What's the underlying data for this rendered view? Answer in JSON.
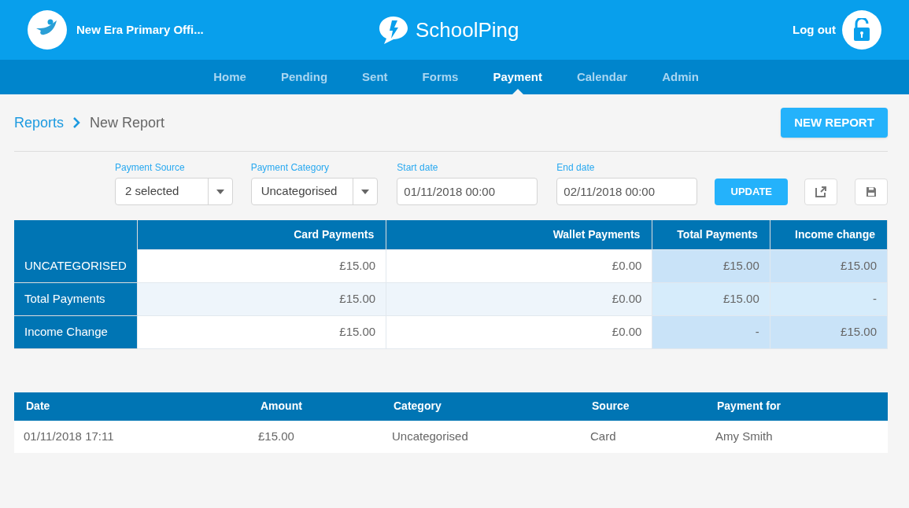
{
  "header": {
    "school_name": "New Era Primary Offi...",
    "brand": "SchoolPing",
    "logout": "Log out"
  },
  "nav": [
    {
      "label": "Home",
      "selected": false
    },
    {
      "label": "Pending",
      "selected": false
    },
    {
      "label": "Sent",
      "selected": false
    },
    {
      "label": "Forms",
      "selected": false
    },
    {
      "label": "Payment",
      "selected": true
    },
    {
      "label": "Calendar",
      "selected": false
    },
    {
      "label": "Admin",
      "selected": false
    }
  ],
  "breadcrumb": {
    "parent": "Reports",
    "current": "New Report"
  },
  "new_report_button": "NEW REPORT",
  "filters": {
    "payment_source": {
      "label": "Payment Source",
      "value": "2 selected"
    },
    "payment_category": {
      "label": "Payment Category",
      "value": "Uncategorised"
    },
    "start_date": {
      "label": "Start date",
      "value": "01/11/2018 00:00"
    },
    "end_date": {
      "label": "End date",
      "value": "02/11/2018 00:00"
    },
    "update_button": "UPDATE"
  },
  "summary_table": {
    "columns": [
      "Card Payments",
      "Wallet Payments",
      "Total Payments",
      "Income change"
    ],
    "rows": [
      {
        "label": "UNCATEGORISED",
        "cells": [
          "£15.00",
          "£0.00",
          "£15.00",
          "£15.00"
        ]
      },
      {
        "label": "Total Payments",
        "cells": [
          "£15.00",
          "£0.00",
          "£15.00",
          "-"
        ]
      },
      {
        "label": "Income Change",
        "cells": [
          "£15.00",
          "£0.00",
          "-",
          "£15.00"
        ]
      }
    ]
  },
  "transactions": {
    "columns": [
      "Date",
      "Amount",
      "Category",
      "Source",
      "Payment for"
    ],
    "rows": [
      [
        "01/11/2018 17:11",
        "£15.00",
        "Uncategorised",
        "Card",
        "Amy Smith"
      ]
    ]
  }
}
